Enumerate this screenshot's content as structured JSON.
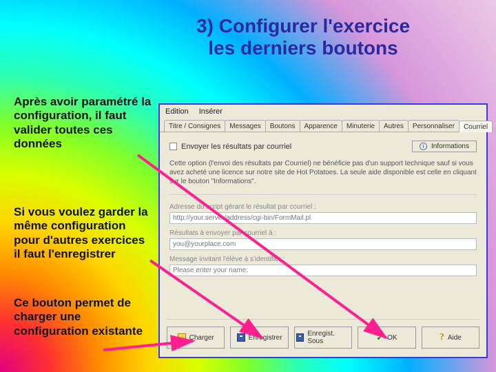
{
  "title": "3) Configurer l'exercice\nles derniers boutons",
  "paragraphs": {
    "p1": "Après avoir paramétré la configuration, il faut valider toutes ces données",
    "p2": "Si vous voulez garder la même configuration pour d'autres exercices il faut l'enregistrer",
    "p3": "Ce bouton permet de charger une configuration existante"
  },
  "dialog": {
    "menu": {
      "edit": "Edition",
      "insert": "Insérer"
    },
    "tabs": [
      "Titre / Consignes",
      "Messages",
      "Boutons",
      "Apparence",
      "Minuterie",
      "Autres",
      "Personnaliser",
      "Courriel"
    ],
    "activeTabIndex": 7,
    "checkbox_label": "Envoyer les résultats par courriel",
    "info_button": "Informations",
    "description": "Cette option (l'envoi des résultats par Courriel) ne bénéficie pas d'un support technique sauf si vous avez acheté une licence sur notre site de Hot Potatoes. La seule aide disponible est celle en cliquant sur le bouton \"Informations\".",
    "field1_label": "Adresse du script gérant le résultat par courriel :",
    "field1_value": "http://your.server/address/cgi-bin/FormMail.pl",
    "field2_label": "Résultats à envoyer par courriel à :",
    "field2_value": "you@yourplace.com",
    "field3_label": "Message invitant l'élève à s'identifier :",
    "field3_value": "Please enter your name:",
    "buttons": {
      "load": "Charger",
      "save": "Enregistrer",
      "saveas": "Enregist. Sous",
      "ok": "OK",
      "help": "Aide"
    }
  }
}
